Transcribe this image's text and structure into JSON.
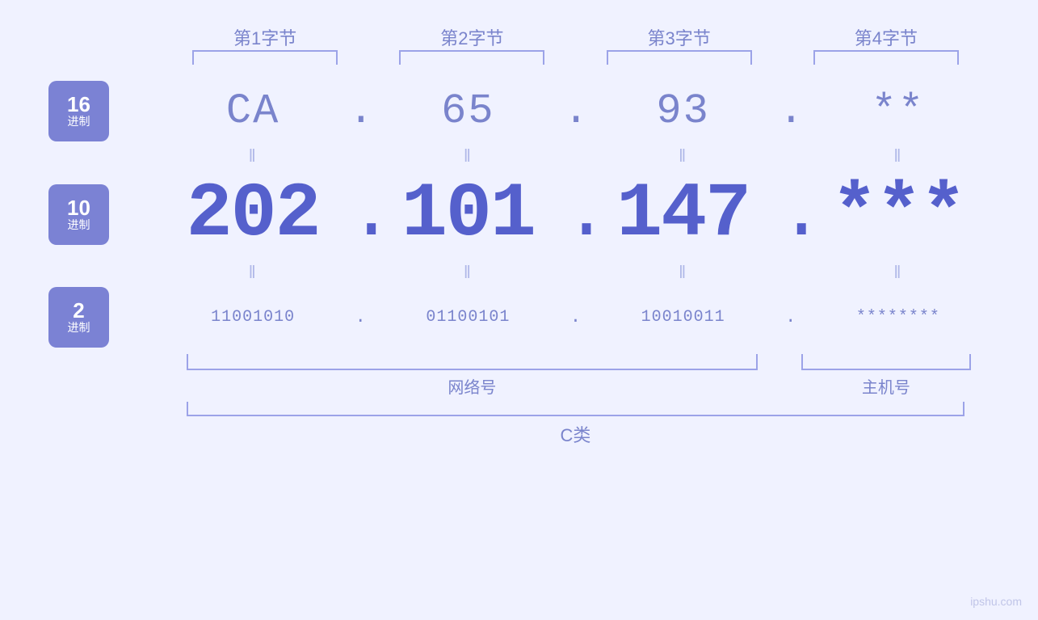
{
  "headers": {
    "col1": "第1字节",
    "col2": "第2字节",
    "col3": "第3字节",
    "col4": "第4字节"
  },
  "rows": {
    "hex": {
      "label_num": "16",
      "label_unit": "进制",
      "v1": "CA",
      "v2": "65",
      "v3": "93",
      "v4": "**"
    },
    "dec": {
      "label_num": "10",
      "label_unit": "进制",
      "v1": "202",
      "v2": "101",
      "v3": "147",
      "v4": "***"
    },
    "bin": {
      "label_num": "2",
      "label_unit": "进制",
      "v1": "11001010",
      "v2": "01100101",
      "v3": "10010011",
      "v4": "********"
    }
  },
  "labels": {
    "network": "网络号",
    "host": "主机号",
    "class": "C类"
  },
  "watermark": "ipshu.com",
  "dot": "."
}
